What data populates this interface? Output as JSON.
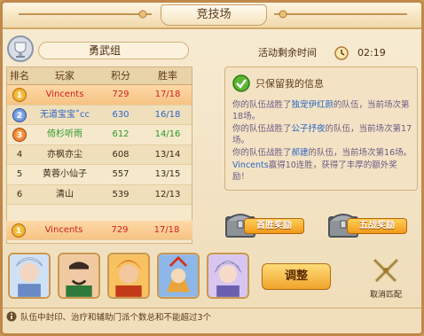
{
  "title": "竞技场",
  "group": {
    "label": "勇武组"
  },
  "timer": {
    "label": "活动剩余时间",
    "value": "02:19"
  },
  "table": {
    "headers": [
      "排名",
      "玩家",
      "积分",
      "胜率"
    ],
    "rows": [
      {
        "rank": "1",
        "player": "Vincents",
        "score": "729",
        "rate": "17/18",
        "medal": "gold",
        "player_color": "#d02020",
        "mine": true
      },
      {
        "rank": "2",
        "player": "无道宝宝˚cc",
        "score": "630",
        "rate": "16/18",
        "medal": "silver",
        "player_color": "#2b66c6",
        "mine": false
      },
      {
        "rank": "3",
        "player": "倚杉听雨",
        "score": "612",
        "rate": "14/16",
        "medal": "bronze",
        "player_color": "#2a9a2a",
        "mine": false
      },
      {
        "rank": "4",
        "player": "亦枫亦尘",
        "score": "608",
        "rate": "13/14",
        "medal": "",
        "player_color": "#3c2a18",
        "mine": false
      },
      {
        "rank": "5",
        "player": "黄蓉小仙子",
        "score": "557",
        "rate": "13/15",
        "medal": "",
        "player_color": "#3c2a18",
        "mine": false
      },
      {
        "rank": "6",
        "player": "清山",
        "score": "539",
        "rate": "12/13",
        "medal": "",
        "player_color": "#3c2a18",
        "mine": false
      }
    ],
    "my_row": {
      "rank": "1",
      "player": "Vincents",
      "score": "729",
      "rate": "17/18"
    }
  },
  "info": {
    "keep_label": "只保留我的信息",
    "log": [
      {
        "pre": "你的队伍战胜了",
        "name": "独宠伊红颜",
        "post": "的队伍，当前场次第18场。"
      },
      {
        "pre": "你的队伍战胜了",
        "name": "公子抒夜",
        "post": "的队伍，当前场次第17场。"
      },
      {
        "pre": "你的队伍战胜了",
        "name": "郝建",
        "post": "的队伍，当前场次第16场。"
      },
      {
        "pre": "",
        "name": "Vincents",
        "post": "赢得10连胜，获得了丰厚的额外奖励！"
      }
    ]
  },
  "rewards": [
    {
      "label": "首胜奖励",
      "icon": "treasure-chest-icon"
    },
    {
      "label": "五战奖励",
      "icon": "treasure-chest-icon"
    }
  ],
  "team": {
    "heroes": [
      "hero-portrait-1",
      "hero-portrait-2",
      "hero-portrait-3",
      "hero-portrait-4",
      "hero-portrait-5"
    ],
    "adjust_label": "调整",
    "cancel_label": "取消匹配"
  },
  "footer": {
    "tip": "队伍中封印、治疗和辅助门派个数总和不能超过3个"
  },
  "colors": {
    "accent": "#f0a42b",
    "frame": "#c0884a",
    "highlight": "#2b66c6"
  }
}
